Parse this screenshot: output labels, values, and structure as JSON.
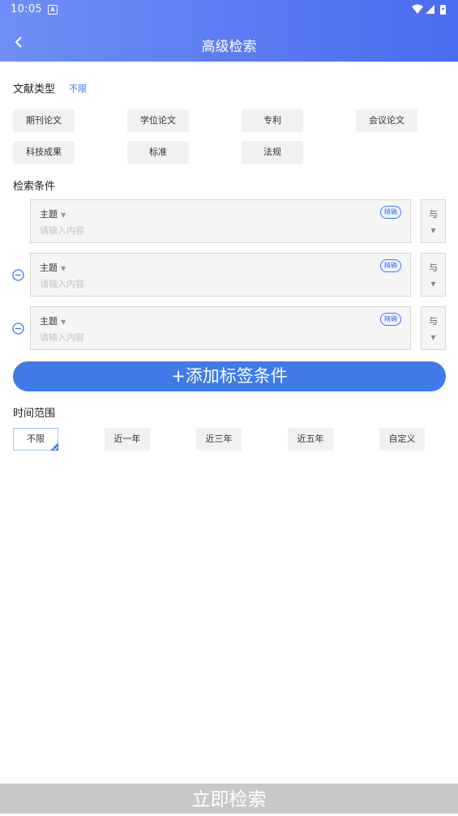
{
  "status_bar": {
    "time": "10:05",
    "notification_icon": "A"
  },
  "header": {
    "title": "高级检索",
    "back_icon": "chevron-left-icon"
  },
  "doc_type": {
    "label": "文献类型",
    "value": "不限",
    "chips": [
      "期刊论文",
      "学位论文",
      "专利",
      "会议论文",
      "科技成果",
      "标准",
      "法规"
    ]
  },
  "conditions": {
    "label": "检索条件",
    "rows": [
      {
        "field": "主题",
        "placeholder": "请输入内容",
        "match": "精确",
        "logic": "与"
      },
      {
        "field": "主题",
        "placeholder": "请输入内容",
        "match": "精确",
        "logic": "与"
      },
      {
        "field": "主题",
        "placeholder": "请输入内容",
        "match": "精确",
        "logic": "与"
      }
    ],
    "add_button": "+添加标签条件"
  },
  "time_range": {
    "label": "时间范围",
    "options": [
      "不限",
      "近一年",
      "近三年",
      "近五年",
      "自定义"
    ],
    "selected": "不限"
  },
  "search_button": "立即检索",
  "colors": {
    "header_start": "#6f8ef5",
    "header_end": "#4a6cf0",
    "accent": "#3f7ae8",
    "disabled_button": "#c8c8c8"
  }
}
